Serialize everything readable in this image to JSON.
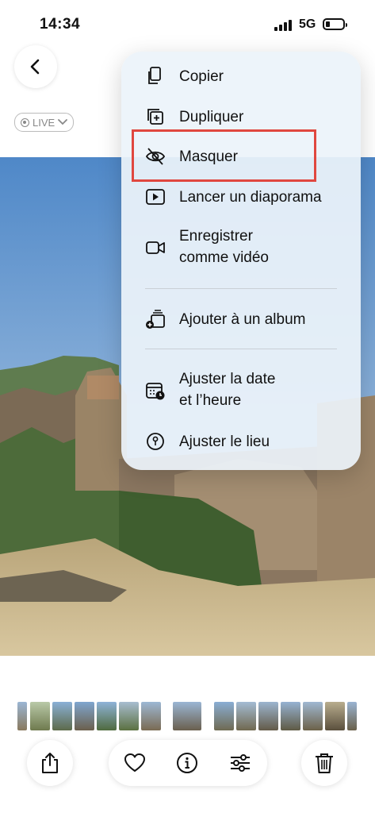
{
  "status_bar": {
    "time": "14:34",
    "network": "5G"
  },
  "header": {
    "back_icon": "chevron-left-icon",
    "live_label": "LIVE"
  },
  "context_menu": {
    "items": [
      {
        "label": "Copier",
        "icon": "copy-icon"
      },
      {
        "label": "Dupliquer",
        "icon": "duplicate-icon"
      },
      {
        "label": "Masquer",
        "icon": "eye-slash-icon",
        "highlighted": true
      },
      {
        "label": "Lancer un diaporama",
        "icon": "play-icon"
      },
      {
        "label": "Enregistrer\ncomme vidéo",
        "icon": "video-icon"
      },
      {
        "label": "Ajouter à un album",
        "icon": "add-album-icon"
      },
      {
        "label": "Ajuster la date\net l’heure",
        "icon": "calendar-clock-icon"
      },
      {
        "label": "Ajuster le lieu",
        "icon": "location-icon"
      }
    ],
    "highlight_color": "#e0473f"
  },
  "toolbar": {
    "share_icon": "share-icon",
    "favorite_icon": "heart-icon",
    "info_icon": "info-icon",
    "adjust_icon": "sliders-icon",
    "delete_icon": "trash-icon"
  },
  "colors": {
    "menu_bg": "#ecf3fa",
    "highlight": "#e0473f"
  }
}
